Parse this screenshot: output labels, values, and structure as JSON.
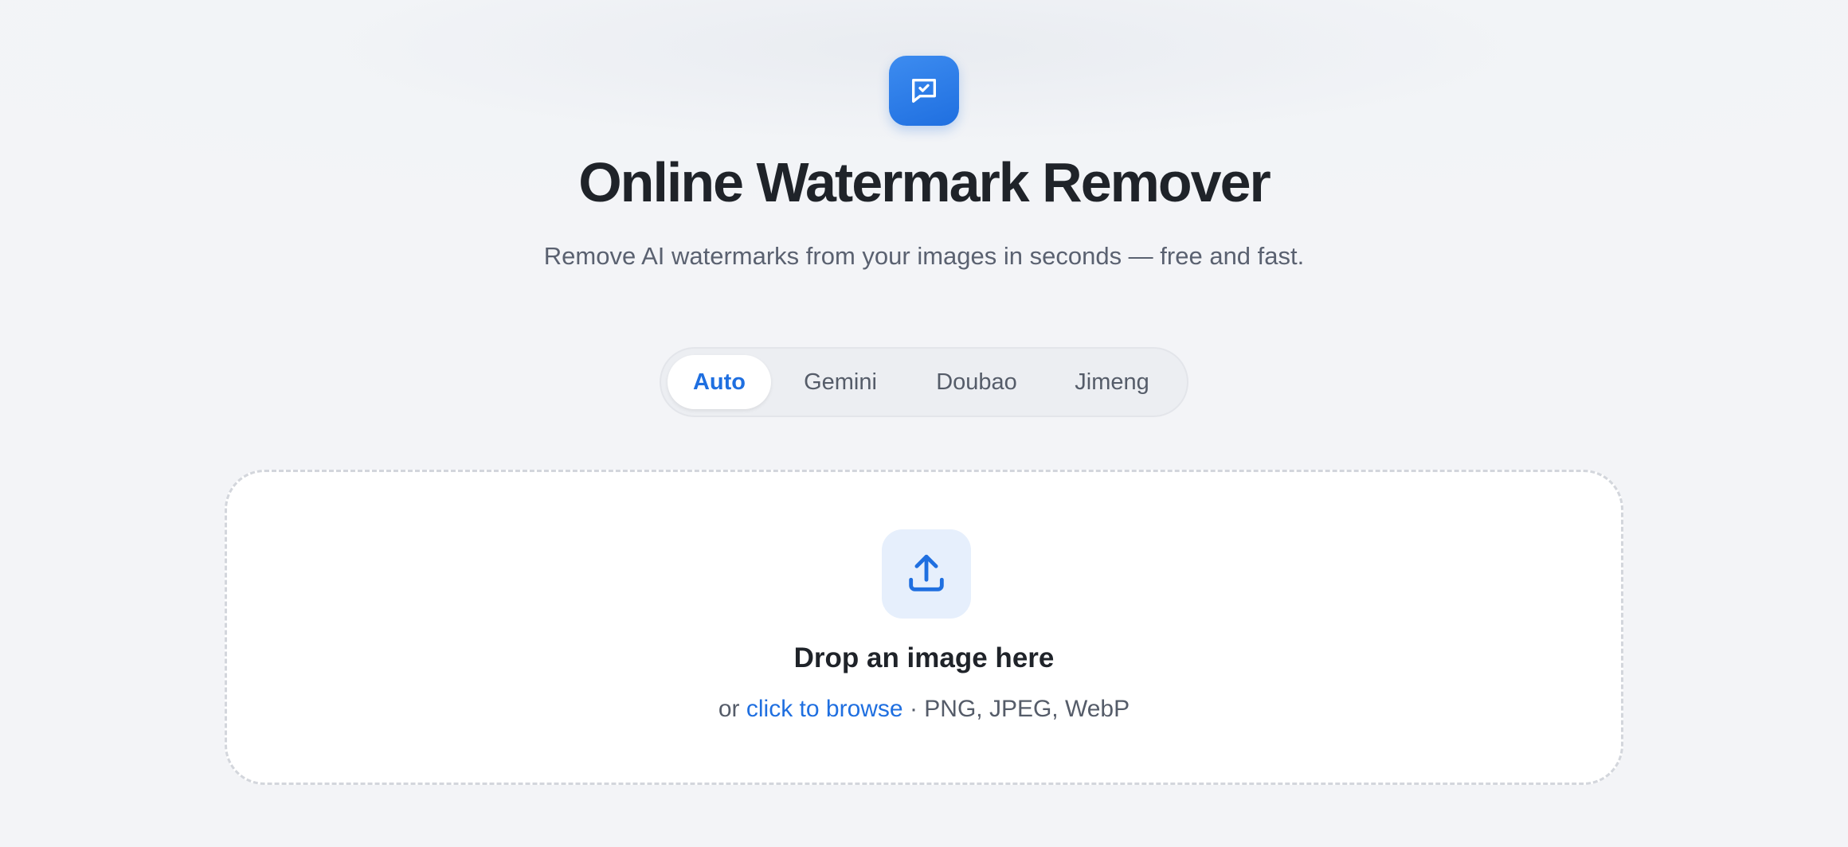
{
  "header": {
    "logo_icon": "message-check-icon",
    "title": "Online Watermark Remover",
    "subtitle": "Remove AI watermarks from your images in seconds — free and fast."
  },
  "tabs": [
    {
      "label": "Auto",
      "active": true
    },
    {
      "label": "Gemini",
      "active": false
    },
    {
      "label": "Doubao",
      "active": false
    },
    {
      "label": "Jimeng",
      "active": false
    }
  ],
  "dropzone": {
    "icon": "upload-icon",
    "title": "Drop an image here",
    "prefix": "or ",
    "browse_link": "click to browse",
    "formats": " · PNG, JPEG, WebP"
  },
  "colors": {
    "accent": "#1f6fe0",
    "background": "#f3f4f7",
    "text_primary": "#1f2329",
    "text_secondary": "#5a6170"
  }
}
